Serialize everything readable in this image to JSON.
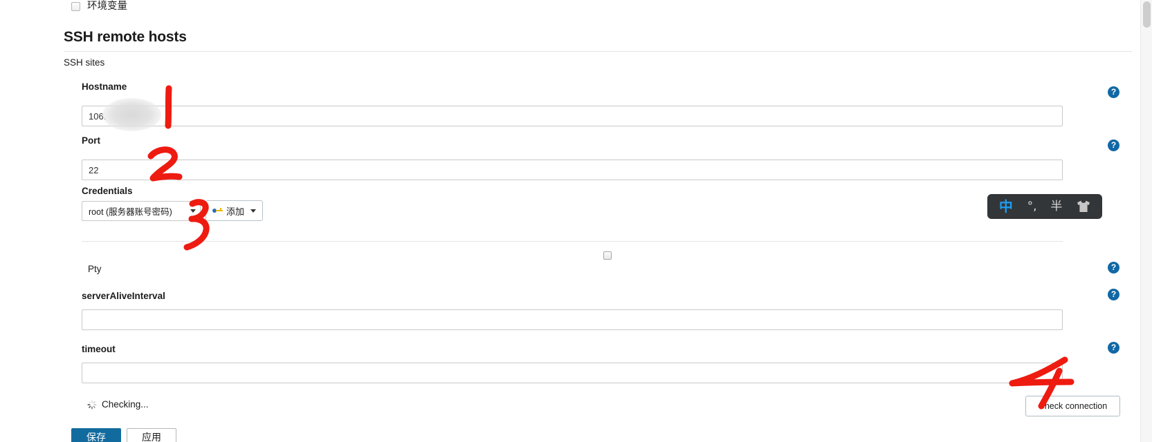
{
  "window": {
    "background": "#ffffff",
    "accent": "#126b9e",
    "help_icon_color": "#1168a5"
  },
  "env_var_row": {
    "label": "环境变量",
    "checked": false,
    "checkbox_name": "env-var-checkbox"
  },
  "section": {
    "title": "SSH remote hosts",
    "subtitle": "SSH sites"
  },
  "fields": {
    "hostname": {
      "label": "Hostname",
      "value": "106.",
      "placeholder": "",
      "redacted": true,
      "help": "?"
    },
    "port": {
      "label": "Port",
      "value": "22",
      "placeholder": "",
      "help": "?"
    },
    "credentials": {
      "label": "Credentials",
      "selected": "root (服务器账号密码)",
      "add_button_label": "添加",
      "add_button_icon": "key-icon",
      "caret_icon": "chevron-down-icon"
    },
    "pty": {
      "label": "Pty",
      "checked": false,
      "help": "?"
    },
    "server_alive_interval": {
      "label": "serverAliveInterval",
      "value": "",
      "placeholder": "",
      "help": "?"
    },
    "timeout": {
      "label": "timeout",
      "value": "",
      "placeholder": "",
      "help": "?"
    }
  },
  "status": {
    "text": "Checking...",
    "icon": "spinner-icon"
  },
  "actions": {
    "check_connection": "Check connection",
    "save": "保存",
    "apply": "应用"
  },
  "ime_bar": {
    "items": [
      {
        "name": "ime-chinese-mode-icon",
        "glyph": "中"
      },
      {
        "name": "ime-punctuation-icon",
        "glyph": "°,"
      },
      {
        "name": "ime-halfwidth-icon",
        "glyph": "半"
      },
      {
        "name": "ime-skin-icon",
        "glyph": "shirt"
      }
    ],
    "background": "#333638",
    "active_color": "#1e9cf0"
  },
  "annotations": {
    "color": "#ee1b11",
    "marks": [
      {
        "name": "annotation-1",
        "label": "1",
        "target": "hostname-field"
      },
      {
        "name": "annotation-2",
        "label": "2",
        "target": "port-field"
      },
      {
        "name": "annotation-3",
        "label": "3",
        "target": "credentials-field"
      },
      {
        "name": "annotation-4",
        "label": "4",
        "target": "check-connection-button"
      }
    ]
  },
  "scrollbar": {
    "name": "vertical-scrollbar",
    "thumb_position": "top"
  }
}
